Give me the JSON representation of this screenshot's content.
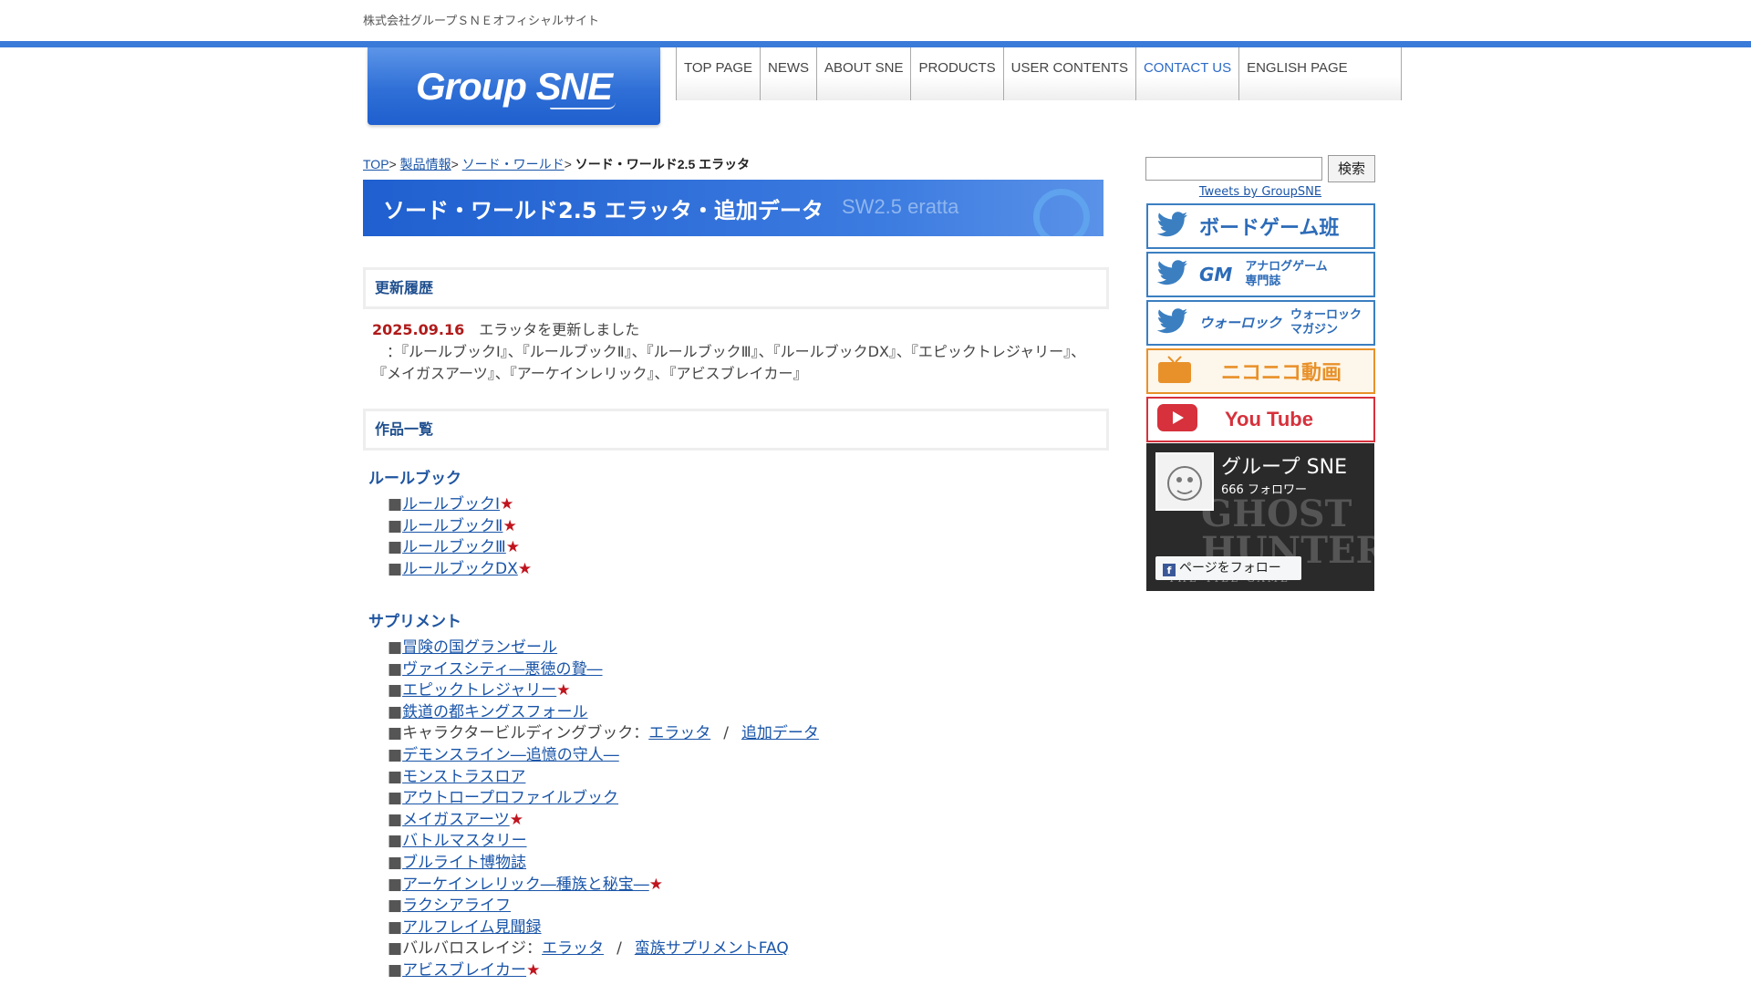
{
  "site_tagline": "株式会社グループＳＮＥオフィシャルサイト",
  "logo_text": "Group SNE",
  "nav": [
    "TOP PAGE",
    "NEWS",
    "ABOUT SNE",
    "PRODUCTS",
    "USER CONTENTS",
    "CONTACT US",
    "ENGLISH PAGE"
  ],
  "nav_active": "CONTACT US",
  "breadcrumb": {
    "items": [
      "TOP",
      "製品情報",
      "ソード・ワールド"
    ],
    "current": "ソード・ワールド2.5 エラッタ"
  },
  "page_title": "ソード・ワールド2.5 エラッタ・追加データ",
  "page_subtitle": "SW2.5 eratta",
  "history": {
    "heading": "更新履歴",
    "date": "2025.09.16",
    "text": "エラッタを更新しました",
    "detail": "：『ルールブックⅠ』、『ルールブックⅡ』、『ルールブックⅢ』、『ルールブックDX』、『エピックトレジャリー』、『メイガスアーツ』、『アーケインレリック』、『アビスブレイカー』"
  },
  "works_heading": "作品一覧",
  "rulebook": {
    "heading": "ルールブック",
    "items": [
      {
        "label": "ルールブックⅠ",
        "star": "★"
      },
      {
        "label": "ルールブックⅡ",
        "star": "★"
      },
      {
        "label": "ルールブックⅢ",
        "star": "★"
      },
      {
        "label": "ルールブックDX",
        "star": "★"
      }
    ]
  },
  "supplement": {
    "heading": "サプリメント",
    "items": [
      {
        "label": "冒険の国グランゼール",
        "star": ""
      },
      {
        "label": "ヴァイスシティ―悪徳の贄―",
        "star": ""
      },
      {
        "label": "エピックトレジャリー",
        "star": "★"
      },
      {
        "label": "鉄道の都キングスフォール",
        "star": ""
      },
      {
        "label": "デモンスライン―追憶の守人―",
        "star": ""
      },
      {
        "label": "モンストラスロア",
        "star": ""
      },
      {
        "label": "アウトロープロファイルブック",
        "star": ""
      },
      {
        "label": "メイガスアーツ",
        "star": "★"
      },
      {
        "label": "バトルマスタリー",
        "star": ""
      },
      {
        "label": "ブルライト博物誌",
        "star": ""
      },
      {
        "label": "アーケインレリック―種族と秘宝―",
        "star": "★"
      },
      {
        "label": "ラクシアライフ",
        "star": ""
      },
      {
        "label": "アルフレイム見聞録",
        "star": ""
      },
      {
        "label": "アビスブレイカー",
        "star": "★"
      }
    ],
    "char_build": {
      "prefix": "キャラクタービルディングブック：",
      "link1": "エラッタ",
      "sep": "/",
      "link2": "追加データ"
    },
    "barbaros": {
      "prefix": "バルバロスレイジ：",
      "link1": "エラッタ",
      "sep": "/",
      "link2": "蛮族サプリメントFAQ"
    }
  },
  "sidebar": {
    "search_button": "検索",
    "tweets_link": "Tweets by GroupSNE",
    "board_game": "ボードゲーム班",
    "gm_logo": "GM",
    "gm_text": [
      "アナログゲーム",
      "専門誌"
    ],
    "warlock_logo": "ウォーロック",
    "warlock_text": [
      "ウォーロック",
      "マガジン"
    ],
    "niconico": "ニコニコ動画",
    "youtube": "You Tube",
    "fb_name": "グループ SNE",
    "fb_followers": "666 フォロワー",
    "fb_follow": "ページをフォロー",
    "fb_bg_title": [
      "GHOST",
      "HUNTER"
    ],
    "fb_bg_sub": "THE TILE GAME"
  },
  "colors": {
    "accent": "#3a7ad9",
    "star": "#c0141e",
    "twitter": "#3b7fc1",
    "nico": "#e8912a",
    "youtube": "#d6313c"
  }
}
